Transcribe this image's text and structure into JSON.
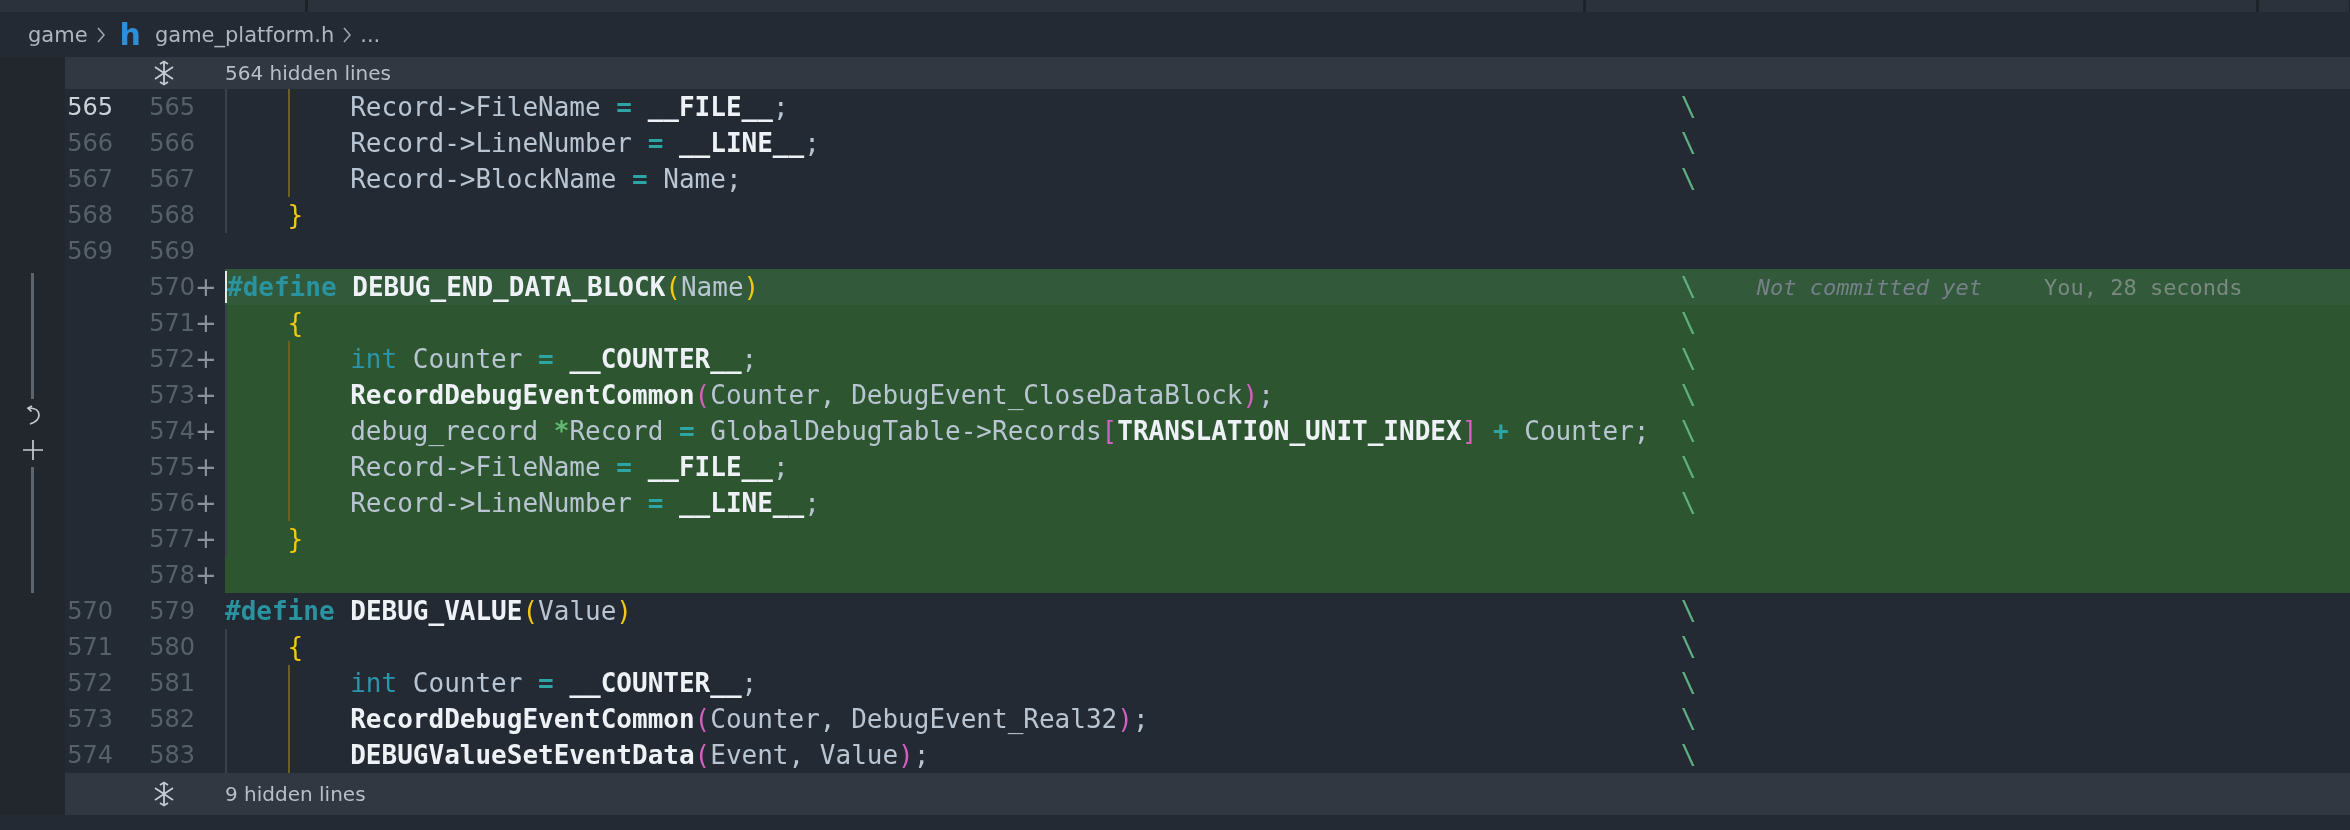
{
  "breadcrumb": {
    "folder": "game",
    "file_icon": "h",
    "file": "game_platform.h",
    "more": "..."
  },
  "hidden_top": {
    "label": "564 hidden lines"
  },
  "lines": [
    {
      "old": "565",
      "new": "565",
      "added": false,
      "active": true,
      "cursor": false,
      "code": [
        {
          "t": "        Record->FileName ",
          "kind": "text"
        },
        {
          "t": "= ",
          "kind": "op"
        },
        {
          "t": "__FILE__",
          "kind": "name"
        },
        {
          "t": ";",
          "kind": "text"
        }
      ],
      "cont": "\\"
    },
    {
      "old": "566",
      "new": "566",
      "added": false,
      "active": false,
      "cursor": false,
      "code": [
        {
          "t": "        Record->LineNumber ",
          "kind": "text"
        },
        {
          "t": "= ",
          "kind": "op"
        },
        {
          "t": "__LINE__",
          "kind": "name"
        },
        {
          "t": ";",
          "kind": "text"
        }
      ],
      "cont": "\\"
    },
    {
      "old": "567",
      "new": "567",
      "added": false,
      "active": false,
      "cursor": false,
      "code": [
        {
          "t": "        Record->BlockName ",
          "kind": "text"
        },
        {
          "t": "=",
          "kind": "op"
        },
        {
          "t": " Name;",
          "kind": "text"
        }
      ],
      "cont": "\\"
    },
    {
      "old": "568",
      "new": "568",
      "added": false,
      "active": false,
      "cursor": false,
      "code": [
        {
          "t": "    }",
          "kind": "brace"
        }
      ]
    },
    {
      "old": "569",
      "new": "569",
      "added": false,
      "active": false,
      "cursor": false
    },
    {
      "new": "570",
      "marker": "+",
      "added": true,
      "active": false,
      "cursor": true,
      "code": [
        {
          "t": "#define ",
          "kind": "directive"
        },
        {
          "t": "DEBUG_END_DATA_BLOCK",
          "kind": "name"
        },
        {
          "t": "(",
          "kind": "brace"
        },
        {
          "t": "Name",
          "kind": "text"
        },
        {
          "t": ")",
          "kind": "brace"
        }
      ],
      "cont": "\\",
      "blame": {
        "message": "Not committed yet",
        "author": "You, 28 seconds"
      }
    },
    {
      "new": "571",
      "marker": "+",
      "added": true,
      "active": false,
      "cursor": false,
      "code": [
        {
          "t": "    {",
          "kind": "brace"
        }
      ],
      "cont": "\\"
    },
    {
      "new": "572",
      "marker": "+",
      "added": true,
      "active": false,
      "cursor": false,
      "code": [
        {
          "t": "        int",
          "kind": "kw"
        },
        {
          "t": " Counter ",
          "kind": "text"
        },
        {
          "t": "= ",
          "kind": "op"
        },
        {
          "t": "__COUNTER__",
          "kind": "name"
        },
        {
          "t": ";",
          "kind": "text"
        }
      ],
      "cont": "\\"
    },
    {
      "new": "573",
      "marker": "+",
      "added": true,
      "active": false,
      "cursor": false,
      "code": [
        {
          "t": "        RecordDebugEventCommon",
          "kind": "name"
        },
        {
          "t": "(",
          "kind": "paren"
        },
        {
          "t": "Counter, DebugEvent_CloseDataBlock",
          "kind": "text"
        },
        {
          "t": ")",
          "kind": "paren"
        },
        {
          "t": ";",
          "kind": "text"
        }
      ],
      "cont": "\\"
    },
    {
      "new": "574",
      "marker": "+",
      "added": true,
      "active": false,
      "cursor": false,
      "code": [
        {
          "t": "        debug_record ",
          "kind": "text"
        },
        {
          "t": "*",
          "kind": "ptr"
        },
        {
          "t": "Record ",
          "kind": "text"
        },
        {
          "t": "=",
          "kind": "op"
        },
        {
          "t": " GlobalDebugTable->Records",
          "kind": "text"
        },
        {
          "t": "[",
          "kind": "paren"
        },
        {
          "t": "TRANSLATION_UNIT_INDEX",
          "kind": "name"
        },
        {
          "t": "]",
          "kind": "paren"
        },
        {
          "t": " + ",
          "kind": "op"
        },
        {
          "t": "Counter;",
          "kind": "text"
        }
      ],
      "cont": "\\"
    },
    {
      "new": "575",
      "marker": "+",
      "added": true,
      "active": false,
      "cursor": false,
      "code": [
        {
          "t": "        Record->FileName ",
          "kind": "text"
        },
        {
          "t": "= ",
          "kind": "op"
        },
        {
          "t": "__FILE__",
          "kind": "name"
        },
        {
          "t": ";",
          "kind": "text"
        }
      ],
      "cont": "\\"
    },
    {
      "new": "576",
      "marker": "+",
      "added": true,
      "active": false,
      "cursor": false,
      "code": [
        {
          "t": "        Record->LineNumber ",
          "kind": "text"
        },
        {
          "t": "= ",
          "kind": "op"
        },
        {
          "t": "__LINE__",
          "kind": "name"
        },
        {
          "t": ";",
          "kind": "text"
        }
      ],
      "cont": "\\"
    },
    {
      "new": "577",
      "marker": "+",
      "added": true,
      "active": false,
      "cursor": false,
      "code": [
        {
          "t": "    }",
          "kind": "brace"
        }
      ]
    },
    {
      "new": "578",
      "marker": "+",
      "added": true,
      "active": false,
      "cursor": false
    },
    {
      "old": "570",
      "new": "579",
      "added": false,
      "active": false,
      "cursor": false,
      "code": [
        {
          "t": "#define ",
          "kind": "directive"
        },
        {
          "t": "DEBUG_VALUE",
          "kind": "name"
        },
        {
          "t": "(",
          "kind": "brace"
        },
        {
          "t": "Value",
          "kind": "text"
        },
        {
          "t": ")",
          "kind": "brace"
        }
      ],
      "cont": "\\"
    },
    {
      "old": "571",
      "new": "580",
      "added": false,
      "active": false,
      "cursor": false,
      "code": [
        {
          "t": "    {",
          "kind": "brace"
        }
      ],
      "cont": "\\"
    },
    {
      "old": "572",
      "new": "581",
      "added": false,
      "active": false,
      "cursor": false,
      "code": [
        {
          "t": "        int",
          "kind": "kw"
        },
        {
          "t": " Counter ",
          "kind": "text"
        },
        {
          "t": "= ",
          "kind": "op"
        },
        {
          "t": "__COUNTER__",
          "kind": "name"
        },
        {
          "t": ";",
          "kind": "text"
        }
      ],
      "cont": "\\"
    },
    {
      "old": "573",
      "new": "582",
      "added": false,
      "active": false,
      "cursor": false,
      "code": [
        {
          "t": "        RecordDebugEventCommon",
          "kind": "name"
        },
        {
          "t": "(",
          "kind": "paren"
        },
        {
          "t": "Counter, DebugEvent_Real32",
          "kind": "text"
        },
        {
          "t": ")",
          "kind": "paren"
        },
        {
          "t": ";",
          "kind": "text"
        }
      ],
      "cont": "\\"
    },
    {
      "old": "574",
      "new": "583",
      "added": false,
      "active": false,
      "cursor": false,
      "code": [
        {
          "t": "        DEBUGValueSetEventData",
          "kind": "name"
        },
        {
          "t": "(",
          "kind": "paren"
        },
        {
          "t": "Event, Value",
          "kind": "text"
        },
        {
          "t": ")",
          "kind": "paren"
        },
        {
          "t": ";",
          "kind": "text"
        }
      ],
      "cont": "\\"
    }
  ],
  "hidden_bottom": {
    "label": "9 hidden lines"
  }
}
